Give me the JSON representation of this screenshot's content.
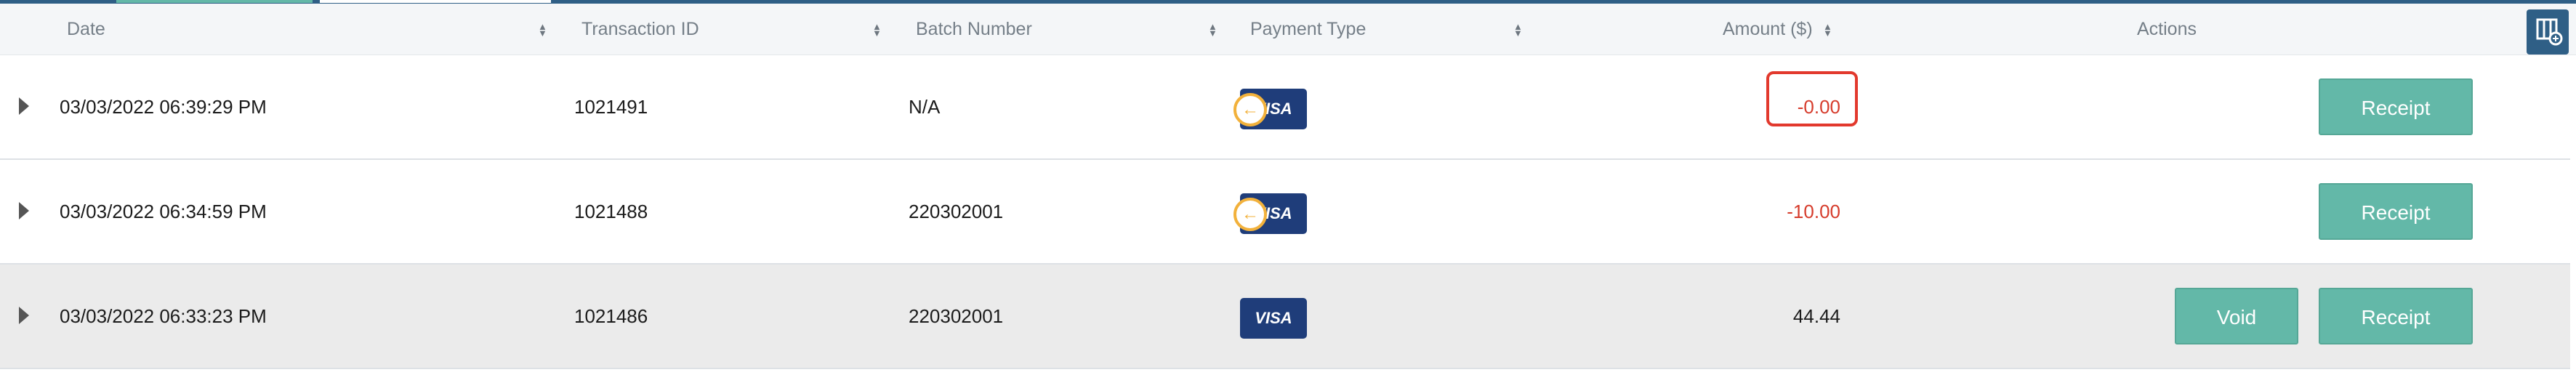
{
  "header": {
    "date": "Date",
    "transaction_id": "Transaction ID",
    "batch_number": "Batch Number",
    "payment_type": "Payment Type",
    "amount": "Amount ($)",
    "actions": "Actions"
  },
  "rows": [
    {
      "date": "03/03/2022 06:39:29 PM",
      "transaction_id": "1021491",
      "batch_number": "N/A",
      "card_brand": "VISA",
      "refund_marker": true,
      "amount": "-0.00",
      "amount_highlighted": true,
      "actions": {
        "receipt": "Receipt"
      }
    },
    {
      "date": "03/03/2022 06:34:59 PM",
      "transaction_id": "1021488",
      "batch_number": "220302001",
      "card_brand": "VISA",
      "refund_marker": true,
      "amount": "-10.00",
      "amount_highlighted": false,
      "actions": {
        "receipt": "Receipt"
      }
    },
    {
      "date": "03/03/2022 06:33:23 PM",
      "transaction_id": "1021486",
      "batch_number": "220302001",
      "card_brand": "VISA",
      "refund_marker": false,
      "amount": "44.44",
      "amount_highlighted": false,
      "actions": {
        "void": "Void",
        "receipt": "Receipt"
      }
    }
  ],
  "icons": {
    "sort": "sort-icon",
    "expand": "expand-caret-icon",
    "column_settings": "column-settings-icon",
    "refund": "refund-arrow-icon"
  },
  "colors": {
    "accent": "#63b8a8",
    "header_bar": "#2f5f86",
    "negative_amount": "#d63c2c",
    "highlight_border": "#e2392d",
    "visa_blue": "#1f3d7a",
    "refund_marker": "#f2b13b"
  }
}
